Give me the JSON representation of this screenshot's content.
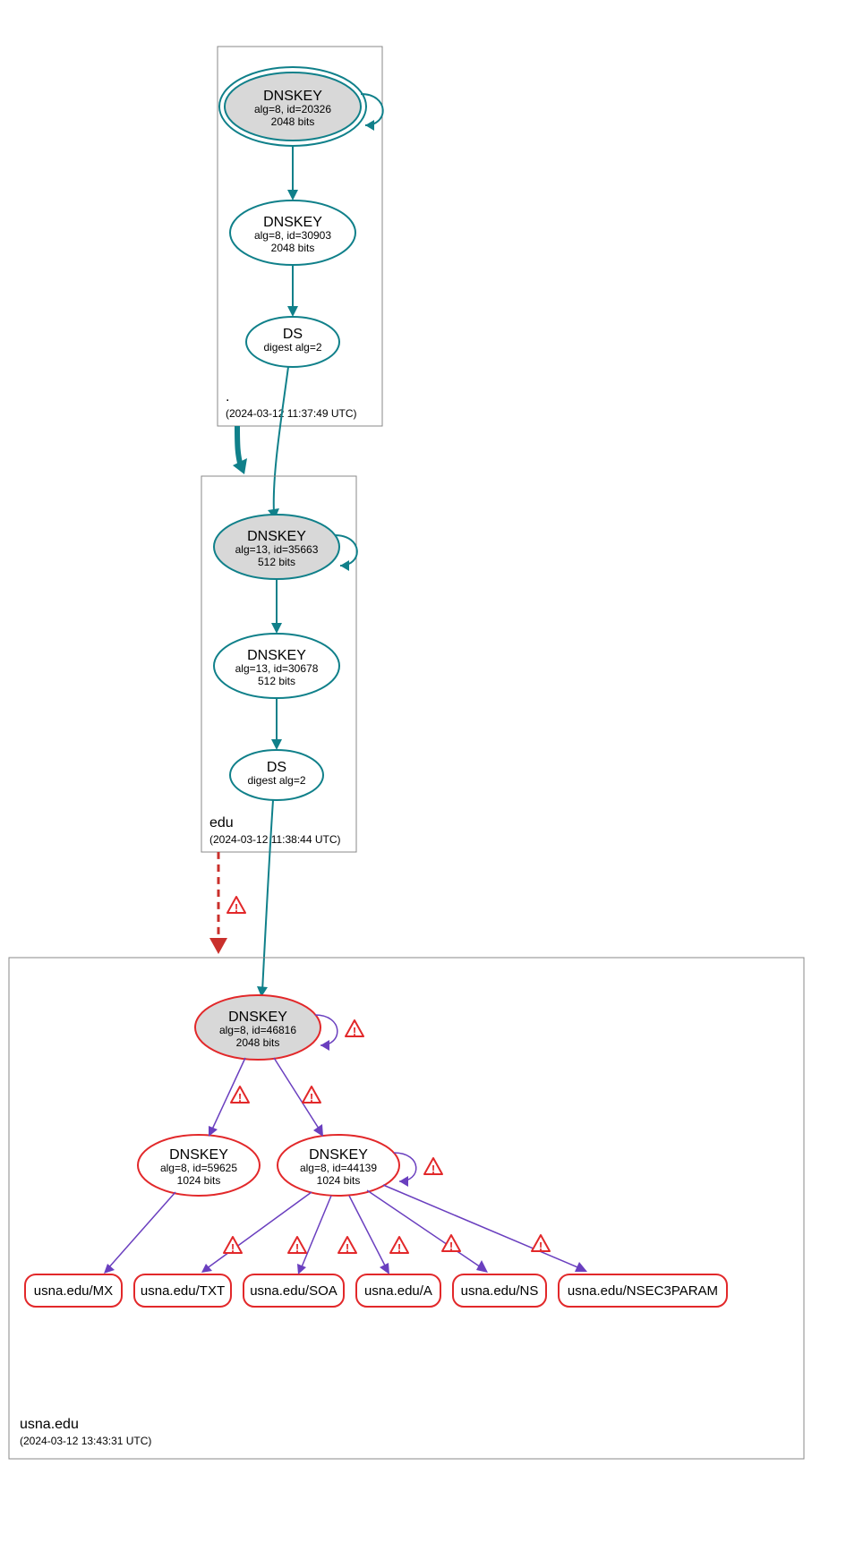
{
  "zones": {
    "root": {
      "name": ".",
      "timestamp": "(2024-03-12 11:37:49 UTC)"
    },
    "edu": {
      "name": "edu",
      "timestamp": "(2024-03-12 11:38:44 UTC)"
    },
    "usna": {
      "name": "usna.edu",
      "timestamp": "(2024-03-12 13:43:31 UTC)"
    }
  },
  "nodes": {
    "root_ksk": {
      "title": "DNSKEY",
      "sub1": "alg=8, id=20326",
      "sub2": "2048 bits"
    },
    "root_zsk": {
      "title": "DNSKEY",
      "sub1": "alg=8, id=30903",
      "sub2": "2048 bits"
    },
    "root_ds": {
      "title": "DS",
      "sub1": "digest alg=2"
    },
    "edu_ksk": {
      "title": "DNSKEY",
      "sub1": "alg=13, id=35663",
      "sub2": "512 bits"
    },
    "edu_zsk": {
      "title": "DNSKEY",
      "sub1": "alg=13, id=30678",
      "sub2": "512 bits"
    },
    "edu_ds": {
      "title": "DS",
      "sub1": "digest alg=2"
    },
    "usna_ksk": {
      "title": "DNSKEY",
      "sub1": "alg=8, id=46816",
      "sub2": "2048 bits"
    },
    "usna_zsk1": {
      "title": "DNSKEY",
      "sub1": "alg=8, id=59625",
      "sub2": "1024 bits"
    },
    "usna_zsk2": {
      "title": "DNSKEY",
      "sub1": "alg=8, id=44139",
      "sub2": "1024 bits"
    }
  },
  "rrsets": {
    "mx": "usna.edu/MX",
    "txt": "usna.edu/TXT",
    "soa": "usna.edu/SOA",
    "a": "usna.edu/A",
    "ns": "usna.edu/NS",
    "nsec": "usna.edu/NSEC3PARAM"
  }
}
